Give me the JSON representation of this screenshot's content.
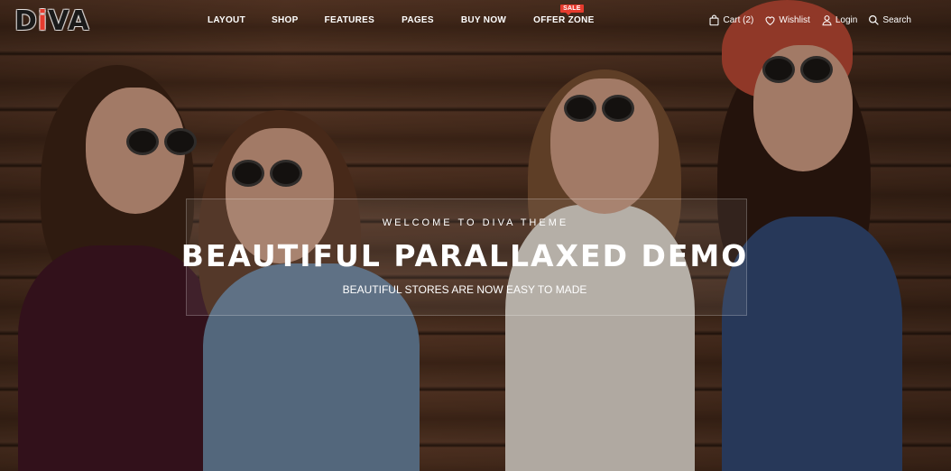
{
  "brand": {
    "logo_prefix": "D",
    "logo_accent": "i",
    "logo_suffix": "VA",
    "accent_color": "#e63b2e"
  },
  "nav": {
    "items": [
      {
        "label": "LAYOUT"
      },
      {
        "label": "SHOP"
      },
      {
        "label": "FEATURES"
      },
      {
        "label": "PAGES"
      },
      {
        "label": "BUY NOW"
      },
      {
        "label": "OFFER ZONE",
        "badge": "SALE"
      }
    ]
  },
  "actions": {
    "cart_label": "Cart (2)",
    "wishlist_label": "Wishlist",
    "login_label": "Login",
    "search_label": "Search",
    "icons": [
      "bag-icon",
      "heart-icon",
      "user-icon",
      "search-icon"
    ]
  },
  "hero": {
    "welcome": "WELCOME TO DIVA THEME",
    "headline": "BEAUTIFUL PARALLAXED DEMO",
    "subline": "BEAUTIFUL STORES ARE NOW EASY TO MADE"
  }
}
